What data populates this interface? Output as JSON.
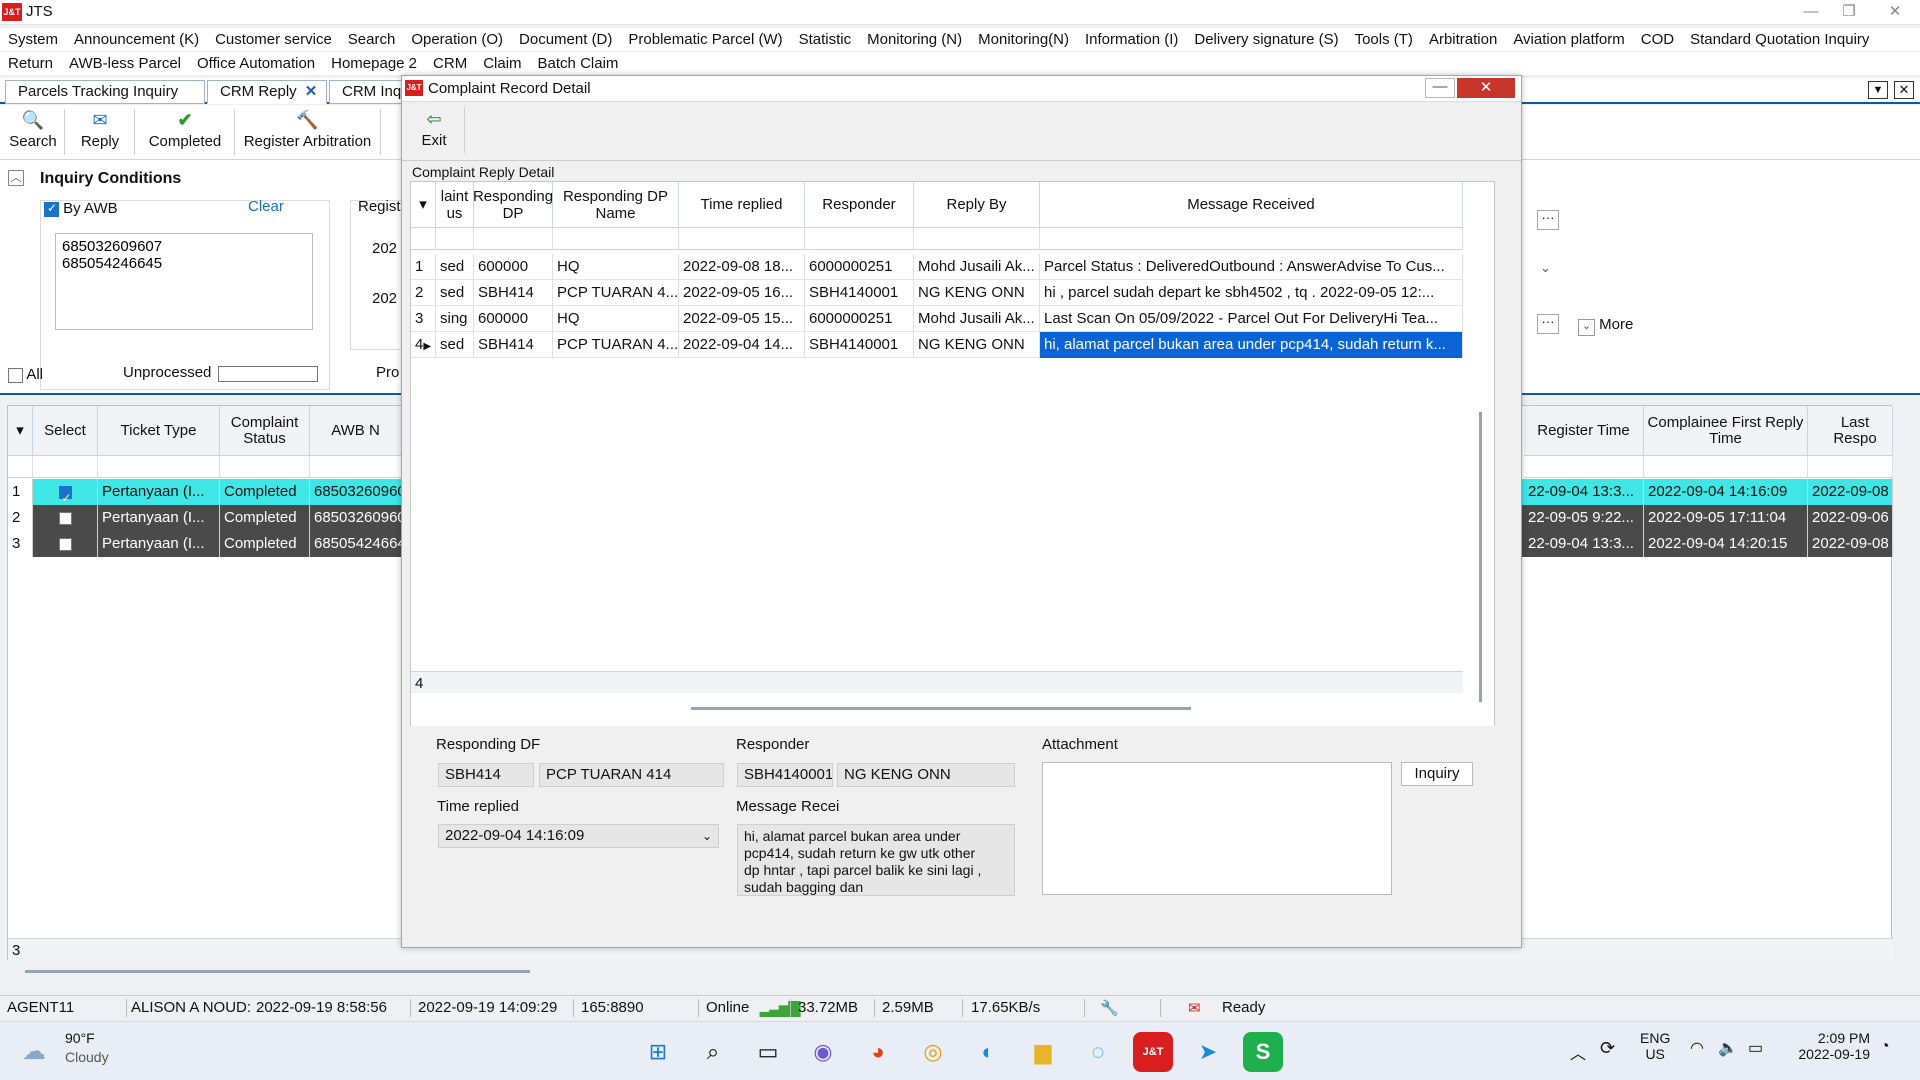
{
  "app": {
    "title": "JTS",
    "logo": "J&T"
  },
  "menu1": [
    "System",
    "Announcement (K)",
    "Customer service",
    "Search",
    "Operation (O)",
    "Document (D)",
    "Problematic Parcel (W)",
    "Statistic",
    "Monitoring (N)",
    "Monitoring(N)",
    "Information (I)",
    "Delivery signature (S)",
    "Tools (T)",
    "Arbitration",
    "Aviation platform",
    "COD",
    "Standard Quotation Inquiry"
  ],
  "menu2": [
    "Return",
    "AWB-less Parcel",
    "Office Automation",
    "Homepage 2",
    "CRM",
    "Claim",
    "Batch Claim"
  ],
  "tabs": [
    {
      "label": "Parcels Tracking Inquiry"
    },
    {
      "label": "CRM Reply",
      "close": "✕"
    },
    {
      "label": "CRM Inq"
    }
  ],
  "toolbar": {
    "search": "Search",
    "reply": "Reply",
    "completed": "Completed",
    "register_arbitration": "Register Arbitration"
  },
  "inquiry": {
    "title": "Inquiry Conditions",
    "by_awb": "By AWB",
    "clear": "Clear",
    "awbs": "685032609607\n685054246645",
    "all": "All",
    "unprocessed": "Unprocessed",
    "pro": "Pro",
    "regist": "Regist",
    "date1": "202",
    "date2": "202",
    "more": "More",
    "ellipsis": "···"
  },
  "grid": {
    "headers": {
      "select": "Select",
      "ticket_type": "Ticket Type",
      "complaint_status": "Complaint Status",
      "awb": "AWB N",
      "register_time": "Register Time",
      "first_reply": "Complainee First Reply Time",
      "last_response": "Last Respo"
    },
    "rows": [
      {
        "num": "1",
        "ticket_type": "Pertanyaan (I...",
        "status": "Completed",
        "awb": "68503260960",
        "register_time": "22-09-04 13:3...",
        "first_reply": "2022-09-04 14:16:09",
        "last": "2022-09-08",
        "checked": true
      },
      {
        "num": "2",
        "ticket_type": "Pertanyaan (I...",
        "status": "Completed",
        "awb": "68503260960",
        "register_time": "22-09-05 9:22...",
        "first_reply": "2022-09-05 17:11:04",
        "last": "2022-09-06",
        "checked": false
      },
      {
        "num": "3",
        "ticket_type": "Pertanyaan (I...",
        "status": "Completed",
        "awb": "68505424664",
        "register_time": "22-09-04 13:3...",
        "first_reply": "2022-09-04 14:20:15",
        "last": "2022-09-08",
        "checked": false
      }
    ],
    "count": "3"
  },
  "modal": {
    "title": "Complaint Record Detail",
    "exit": "Exit",
    "section": "Complaint Reply Detail",
    "headers": {
      "status": "laint\nus",
      "dp": "Responding\nDP",
      "dp_name": "Responding DP Name",
      "time": "Time replied",
      "responder": "Responder",
      "reply_by": "Reply By",
      "message": "Message Received"
    },
    "rows": [
      {
        "num": "1",
        "status": "sed",
        "dp": "600000",
        "dp_name": "HQ",
        "time": "2022-09-08 18...",
        "responder": "6000000251",
        "reply_by": "Mohd Jusaili Ak...",
        "message": "Parcel Status : DeliveredOutbound : AnswerAdvise To Cus..."
      },
      {
        "num": "2",
        "status": "sed",
        "dp": "SBH414",
        "dp_name": "PCP TUARAN 4...",
        "time": "2022-09-05 16...",
        "responder": "SBH4140001",
        "reply_by": "NG KENG ONN",
        "message": "hi , parcel sudah depart ke sbh4502 , tq . 2022-09-05 12:..."
      },
      {
        "num": "3",
        "status": "sing",
        "dp": "600000",
        "dp_name": "HQ",
        "time": "2022-09-05 15...",
        "responder": "6000000251",
        "reply_by": "Mohd Jusaili Ak...",
        "message": "Last Scan On 05/09/2022 - Parcel Out For DeliveryHi Tea..."
      },
      {
        "num": "4",
        "status": "sed",
        "dp": "SBH414",
        "dp_name": "PCP TUARAN 4...",
        "time": "2022-09-04 14...",
        "responder": "SBH4140001",
        "reply_by": "NG KENG ONN",
        "message": "hi, alamat parcel bukan area under pcp414, sudah return k..."
      }
    ],
    "count": "4",
    "detail": {
      "responding_dp_label": "Responding DF",
      "dp_code": "SBH414",
      "dp_name": "PCP TUARAN 414",
      "time_label": "Time replied",
      "time_value": "2022-09-04 14:16:09",
      "responder_label": "Responder",
      "responder_code": "SBH4140001",
      "responder_name": "NG KENG ONN",
      "message_label": "Message Recei",
      "message_value": "hi, alamat parcel bukan area under pcp414, sudah return ke gw utk other dp hntar , tapi parcel balik ke sini lagi , sudah bagging dan",
      "attachment_label": "Attachment",
      "inquiry_button": "Inquiry"
    }
  },
  "status": {
    "agent": "AGENT11",
    "user": "ALISON A NOUD:",
    "login": "2022-09-19 8:58:56",
    "now": "2022-09-19 14:09:29",
    "port": "165:8890",
    "online": "Online",
    "mem1": "33.72MB",
    "mem2": "2.59MB",
    "speed": "17.65KB/s",
    "ready": "Ready"
  },
  "taskbar": {
    "weather_temp": "90°F",
    "weather_desc": "Cloudy",
    "lang1": "ENG",
    "lang2": "US",
    "time": "2:09 PM",
    "date": "2022-09-19"
  },
  "colors": {
    "accent": "#0c5a9e",
    "selected_row": "#3ee6e6",
    "dark_row": "#4a4a4a",
    "selection": "#0a64d6",
    "brand_red": "#d81e1e"
  }
}
